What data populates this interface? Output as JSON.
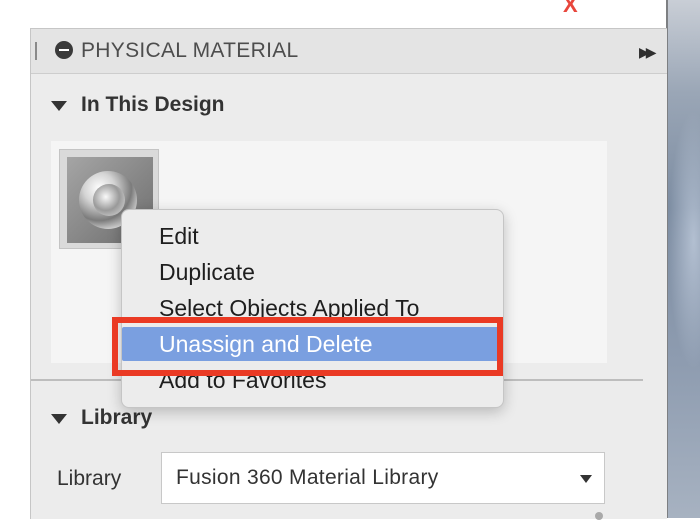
{
  "panel": {
    "title": "PHYSICAL MATERIAL",
    "minus_icon": "minus-circle-icon",
    "expand_icon": "double-chevron-right-icon"
  },
  "in_this_design": {
    "heading": "In This Design",
    "toggle_icon": "triangle-down-icon",
    "swatch_icon": "material-chrome-swatch-icon"
  },
  "context_menu": {
    "items": [
      {
        "label": "Edit",
        "selected": false
      },
      {
        "label": "Duplicate",
        "selected": false
      },
      {
        "label": "Select Objects Applied To",
        "selected": false
      },
      {
        "label": "Unassign and Delete",
        "selected": true
      },
      {
        "label": "Add to Favorites",
        "selected": false
      }
    ],
    "highlight_color": "#ea3a24",
    "selected_color": "#7a9fe0"
  },
  "library_section": {
    "heading": "Library",
    "toggle_icon": "triangle-down-icon",
    "field_label": "Library",
    "selected_value": "Fusion 360 Material Library"
  },
  "top_close_glyph": "X"
}
